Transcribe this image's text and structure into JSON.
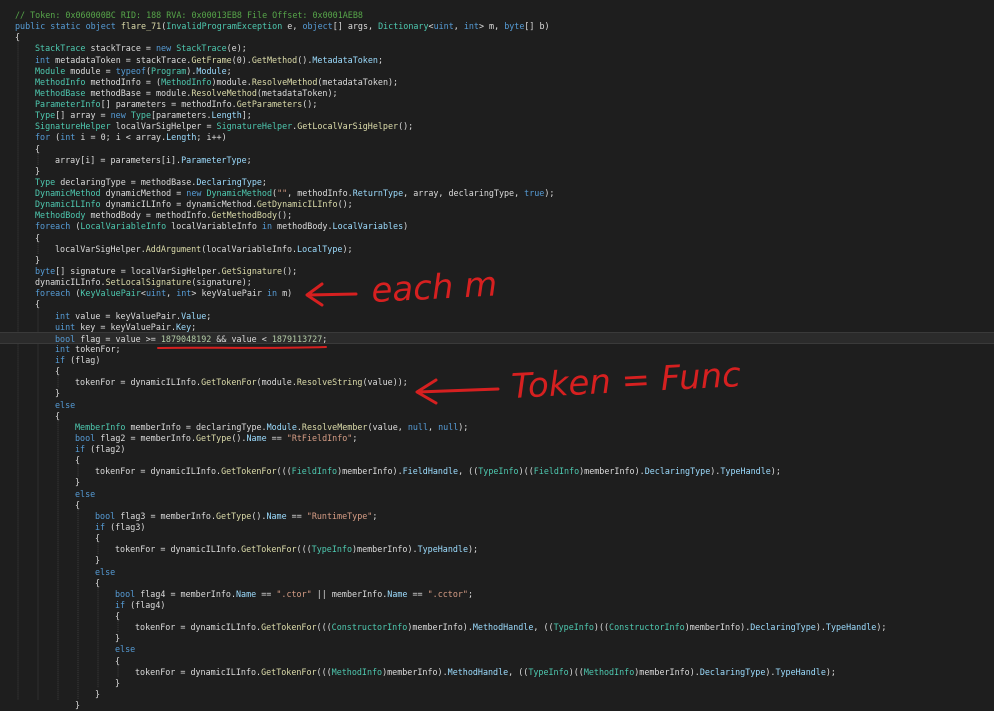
{
  "editor": {
    "lines": [
      [
        [
          "cm",
          "// Token: 0x060000BC RID: 188 RVA: 0x00013EB8 File Offset: 0x0001AEB8"
        ]
      ],
      [
        [
          "kw",
          "public static object "
        ],
        [
          "fn",
          "flare_71"
        ],
        [
          "tx",
          "("
        ],
        [
          "ty",
          "InvalidProgramException"
        ],
        [
          "tx",
          " e, "
        ],
        [
          "kw",
          "object"
        ],
        [
          "tx",
          "[] args, "
        ],
        [
          "ty",
          "Dictionary"
        ],
        [
          "tx",
          "<"
        ],
        [
          "kw",
          "uint"
        ],
        [
          "tx",
          ", "
        ],
        [
          "kw",
          "int"
        ],
        [
          "tx",
          "> m, "
        ],
        [
          "kw",
          "byte"
        ],
        [
          "tx",
          "[] b)"
        ]
      ],
      [
        [
          "tx",
          "{"
        ]
      ],
      [
        [
          "ty",
          "StackTrace"
        ],
        [
          "tx",
          " stackTrace = "
        ],
        [
          "kw",
          "new "
        ],
        [
          "ty",
          "StackTrace"
        ],
        [
          "tx",
          "(e);"
        ]
      ],
      [
        [
          "kw",
          "int"
        ],
        [
          "tx",
          " metadataToken = stackTrace."
        ],
        [
          "fn",
          "GetFrame"
        ],
        [
          "tx",
          "(0)."
        ],
        [
          "fn",
          "GetMethod"
        ],
        [
          "tx",
          "()."
        ],
        [
          "pr",
          "MetadataToken"
        ],
        [
          "tx",
          ";"
        ]
      ],
      [
        [
          "ty",
          "Module"
        ],
        [
          "tx",
          " module = "
        ],
        [
          "kw",
          "typeof"
        ],
        [
          "tx",
          "("
        ],
        [
          "ty",
          "Program"
        ],
        [
          "tx",
          ")."
        ],
        [
          "pr",
          "Module"
        ],
        [
          "tx",
          ";"
        ]
      ],
      [
        [
          "ty",
          "MethodInfo"
        ],
        [
          "tx",
          " methodInfo = ("
        ],
        [
          "ty",
          "MethodInfo"
        ],
        [
          "tx",
          ")module."
        ],
        [
          "fn",
          "ResolveMethod"
        ],
        [
          "tx",
          "(metadataToken);"
        ]
      ],
      [
        [
          "ty",
          "MethodBase"
        ],
        [
          "tx",
          " methodBase = module."
        ],
        [
          "fn",
          "ResolveMethod"
        ],
        [
          "tx",
          "(metadataToken);"
        ]
      ],
      [
        [
          "ty",
          "ParameterInfo"
        ],
        [
          "tx",
          "[] parameters = methodInfo."
        ],
        [
          "fn",
          "GetParameters"
        ],
        [
          "tx",
          "();"
        ]
      ],
      [
        [
          "ty",
          "Type"
        ],
        [
          "tx",
          "[] array = "
        ],
        [
          "kw",
          "new "
        ],
        [
          "ty",
          "Type"
        ],
        [
          "tx",
          "[parameters."
        ],
        [
          "pr",
          "Length"
        ],
        [
          "tx",
          "];"
        ]
      ],
      [
        [
          "ty",
          "SignatureHelper"
        ],
        [
          "tx",
          " localVarSigHelper = "
        ],
        [
          "ty",
          "SignatureHelper"
        ],
        [
          "tx",
          "."
        ],
        [
          "fn",
          "GetLocalVarSigHelper"
        ],
        [
          "tx",
          "();"
        ]
      ],
      [
        [
          "kw",
          "for "
        ],
        [
          "tx",
          "("
        ],
        [
          "kw",
          "int"
        ],
        [
          "tx",
          " i = 0; i < array."
        ],
        [
          "pr",
          "Length"
        ],
        [
          "tx",
          "; i++)"
        ]
      ],
      [
        [
          "tx",
          "{"
        ]
      ],
      [
        [
          "tx",
          "array[i] = parameters[i]."
        ],
        [
          "pr",
          "ParameterType"
        ],
        [
          "tx",
          ";"
        ]
      ],
      [
        [
          "tx",
          "}"
        ]
      ],
      [
        [
          "ty",
          "Type"
        ],
        [
          "tx",
          " declaringType = methodBase."
        ],
        [
          "pr",
          "DeclaringType"
        ],
        [
          "tx",
          ";"
        ]
      ],
      [
        [
          "ty",
          "DynamicMethod"
        ],
        [
          "tx",
          " dynamicMethod = "
        ],
        [
          "kw",
          "new "
        ],
        [
          "ty",
          "DynamicMethod"
        ],
        [
          "tx",
          "("
        ],
        [
          "st",
          "\"\""
        ],
        [
          "tx",
          ", methodInfo."
        ],
        [
          "pr",
          "ReturnType"
        ],
        [
          "tx",
          ", array, declaringType, "
        ],
        [
          "kw",
          "true"
        ],
        [
          "tx",
          ");"
        ]
      ],
      [
        [
          "ty",
          "DynamicILInfo"
        ],
        [
          "tx",
          " dynamicILInfo = dynamicMethod."
        ],
        [
          "fn",
          "GetDynamicILInfo"
        ],
        [
          "tx",
          "();"
        ]
      ],
      [
        [
          "ty",
          "MethodBody"
        ],
        [
          "tx",
          " methodBody = methodInfo."
        ],
        [
          "fn",
          "GetMethodBody"
        ],
        [
          "tx",
          "();"
        ]
      ],
      [
        [
          "kw",
          "foreach "
        ],
        [
          "tx",
          "("
        ],
        [
          "ty",
          "LocalVariableInfo"
        ],
        [
          "tx",
          " localVariableInfo "
        ],
        [
          "kw",
          "in"
        ],
        [
          "tx",
          " methodBody."
        ],
        [
          "pr",
          "LocalVariables"
        ],
        [
          "tx",
          ")"
        ]
      ],
      [
        [
          "tx",
          "{"
        ]
      ],
      [
        [
          "tx",
          "localVarSigHelper."
        ],
        [
          "fn",
          "AddArgument"
        ],
        [
          "tx",
          "(localVariableInfo."
        ],
        [
          "pr",
          "LocalType"
        ],
        [
          "tx",
          ");"
        ]
      ],
      [
        [
          "tx",
          "}"
        ]
      ],
      [
        [
          "kw",
          "byte"
        ],
        [
          "tx",
          "[] signature = localVarSigHelper."
        ],
        [
          "fn",
          "GetSignature"
        ],
        [
          "tx",
          "();"
        ]
      ],
      [
        [
          "tx",
          "dynamicILInfo."
        ],
        [
          "fn",
          "SetLocalSignature"
        ],
        [
          "tx",
          "(signature);"
        ]
      ],
      [
        [
          "kw",
          "foreach "
        ],
        [
          "tx",
          "("
        ],
        [
          "ty",
          "KeyValuePair"
        ],
        [
          "tx",
          "<"
        ],
        [
          "kw",
          "uint"
        ],
        [
          "tx",
          ", "
        ],
        [
          "kw",
          "int"
        ],
        [
          "tx",
          "> keyValuePair "
        ],
        [
          "kw",
          "in"
        ],
        [
          "tx",
          " m)"
        ]
      ],
      [
        [
          "tx",
          "{"
        ]
      ],
      [
        [
          "kw",
          "int"
        ],
        [
          "tx",
          " value = keyValuePair."
        ],
        [
          "pr",
          "Value"
        ],
        [
          "tx",
          ";"
        ]
      ],
      [
        [
          "kw",
          "uint"
        ],
        [
          "tx",
          " key = keyValuePair."
        ],
        [
          "pr",
          "Key"
        ],
        [
          "tx",
          ";"
        ]
      ],
      [
        [
          "kw",
          "bool"
        ],
        [
          "tx",
          " flag = value >= "
        ],
        [
          "nm",
          "1879048192"
        ],
        [
          "tx",
          " && value < "
        ],
        [
          "nm",
          "1879113727"
        ],
        [
          "tx",
          ";"
        ]
      ],
      [
        [
          "kw",
          "int"
        ],
        [
          "tx",
          " tokenFor;"
        ]
      ],
      [
        [
          "kw",
          "if "
        ],
        [
          "tx",
          "(flag)"
        ]
      ],
      [
        [
          "tx",
          "{"
        ]
      ],
      [
        [
          "tx",
          "tokenFor = dynamicILInfo."
        ],
        [
          "fn",
          "GetTokenFor"
        ],
        [
          "tx",
          "(module."
        ],
        [
          "fn",
          "ResolveString"
        ],
        [
          "tx",
          "(value));"
        ]
      ],
      [
        [
          "tx",
          "}"
        ]
      ],
      [
        [
          "kw",
          "else"
        ]
      ],
      [
        [
          "tx",
          "{"
        ]
      ],
      [
        [
          "ty",
          "MemberInfo"
        ],
        [
          "tx",
          " memberInfo = declaringType."
        ],
        [
          "pr",
          "Module"
        ],
        [
          "tx",
          "."
        ],
        [
          "fn",
          "ResolveMember"
        ],
        [
          "tx",
          "(value, "
        ],
        [
          "kw",
          "null"
        ],
        [
          "tx",
          ", "
        ],
        [
          "kw",
          "null"
        ],
        [
          "tx",
          ");"
        ]
      ],
      [
        [
          "kw",
          "bool"
        ],
        [
          "tx",
          " flag2 = memberInfo."
        ],
        [
          "fn",
          "GetType"
        ],
        [
          "tx",
          "()."
        ],
        [
          "pr",
          "Name"
        ],
        [
          "tx",
          " == "
        ],
        [
          "st",
          "\"RtFieldInfo\""
        ],
        [
          "tx",
          ";"
        ]
      ],
      [
        [
          "kw",
          "if "
        ],
        [
          "tx",
          "(flag2)"
        ]
      ],
      [
        [
          "tx",
          "{"
        ]
      ],
      [
        [
          "tx",
          "tokenFor = dynamicILInfo."
        ],
        [
          "fn",
          "GetTokenFor"
        ],
        [
          "tx",
          "((("
        ],
        [
          "ty",
          "FieldInfo"
        ],
        [
          "tx",
          ")memberInfo)."
        ],
        [
          "pr",
          "FieldHandle"
        ],
        [
          "tx",
          ", (("
        ],
        [
          "ty",
          "TypeInfo"
        ],
        [
          "tx",
          ")(("
        ],
        [
          "ty",
          "FieldInfo"
        ],
        [
          "tx",
          ")memberInfo)."
        ],
        [
          "pr",
          "DeclaringType"
        ],
        [
          "tx",
          ")."
        ],
        [
          "pr",
          "TypeHandle"
        ],
        [
          "tx",
          ");"
        ]
      ],
      [
        [
          "tx",
          "}"
        ]
      ],
      [
        [
          "kw",
          "else"
        ]
      ],
      [
        [
          "tx",
          "{"
        ]
      ],
      [
        [
          "kw",
          "bool"
        ],
        [
          "tx",
          " flag3 = memberInfo."
        ],
        [
          "fn",
          "GetType"
        ],
        [
          "tx",
          "()."
        ],
        [
          "pr",
          "Name"
        ],
        [
          "tx",
          " == "
        ],
        [
          "st",
          "\"RuntimeType\""
        ],
        [
          "tx",
          ";"
        ]
      ],
      [
        [
          "kw",
          "if "
        ],
        [
          "tx",
          "(flag3)"
        ]
      ],
      [
        [
          "tx",
          "{"
        ]
      ],
      [
        [
          "tx",
          "tokenFor = dynamicILInfo."
        ],
        [
          "fn",
          "GetTokenFor"
        ],
        [
          "tx",
          "((("
        ],
        [
          "ty",
          "TypeInfo"
        ],
        [
          "tx",
          ")memberInfo)."
        ],
        [
          "pr",
          "TypeHandle"
        ],
        [
          "tx",
          ");"
        ]
      ],
      [
        [
          "tx",
          "}"
        ]
      ],
      [
        [
          "kw",
          "else"
        ]
      ],
      [
        [
          "tx",
          "{"
        ]
      ],
      [
        [
          "kw",
          "bool"
        ],
        [
          "tx",
          " flag4 = memberInfo."
        ],
        [
          "pr",
          "Name"
        ],
        [
          "tx",
          " == "
        ],
        [
          "st",
          "\".ctor\""
        ],
        [
          "tx",
          " || memberInfo."
        ],
        [
          "pr",
          "Name"
        ],
        [
          "tx",
          " == "
        ],
        [
          "st",
          "\".cctor\""
        ],
        [
          "tx",
          ";"
        ]
      ],
      [
        [
          "kw",
          "if "
        ],
        [
          "tx",
          "(flag4)"
        ]
      ],
      [
        [
          "tx",
          "{"
        ]
      ],
      [
        [
          "tx",
          "tokenFor = dynamicILInfo."
        ],
        [
          "fn",
          "GetTokenFor"
        ],
        [
          "tx",
          "((("
        ],
        [
          "ty",
          "ConstructorInfo"
        ],
        [
          "tx",
          ")memberInfo)."
        ],
        [
          "pr",
          "MethodHandle"
        ],
        [
          "tx",
          ", (("
        ],
        [
          "ty",
          "TypeInfo"
        ],
        [
          "tx",
          ")(("
        ],
        [
          "ty",
          "ConstructorInfo"
        ],
        [
          "tx",
          ")memberInfo)."
        ],
        [
          "pr",
          "DeclaringType"
        ],
        [
          "tx",
          ")."
        ],
        [
          "pr",
          "TypeHandle"
        ],
        [
          "tx",
          ");"
        ]
      ],
      [
        [
          "tx",
          "}"
        ]
      ],
      [
        [
          "kw",
          "else"
        ]
      ],
      [
        [
          "tx",
          "{"
        ]
      ],
      [
        [
          "tx",
          "tokenFor = dynamicILInfo."
        ],
        [
          "fn",
          "GetTokenFor"
        ],
        [
          "tx",
          "((("
        ],
        [
          "ty",
          "MethodInfo"
        ],
        [
          "tx",
          ")memberInfo)."
        ],
        [
          "pr",
          "MethodHandle"
        ],
        [
          "tx",
          ", (("
        ],
        [
          "ty",
          "TypeInfo"
        ],
        [
          "tx",
          ")(("
        ],
        [
          "ty",
          "MethodInfo"
        ],
        [
          "tx",
          ")memberInfo)."
        ],
        [
          "pr",
          "DeclaringType"
        ],
        [
          "tx",
          ")."
        ],
        [
          "pr",
          "TypeHandle"
        ],
        [
          "tx",
          ");"
        ]
      ],
      [
        [
          "tx",
          "}"
        ]
      ],
      [
        [
          "tx",
          "}"
        ]
      ],
      [
        [
          "tx",
          "}"
        ]
      ]
    ],
    "indents": [
      0,
      0,
      0,
      1,
      1,
      1,
      1,
      1,
      1,
      1,
      1,
      1,
      1,
      2,
      1,
      1,
      1,
      1,
      1,
      1,
      1,
      2,
      1,
      1,
      1,
      1,
      1,
      2,
      2,
      2,
      2,
      2,
      2,
      3,
      2,
      2,
      2,
      3,
      3,
      3,
      3,
      4,
      3,
      3,
      3,
      4,
      4,
      4,
      5,
      4,
      4,
      4,
      5,
      5,
      5,
      6,
      5,
      5,
      5,
      6,
      5,
      4,
      3
    ],
    "highlight_line": 29
  },
  "annotations": {
    "each_label": "each m",
    "token_label": "Token = Func",
    "ink_color": "#d62020"
  }
}
